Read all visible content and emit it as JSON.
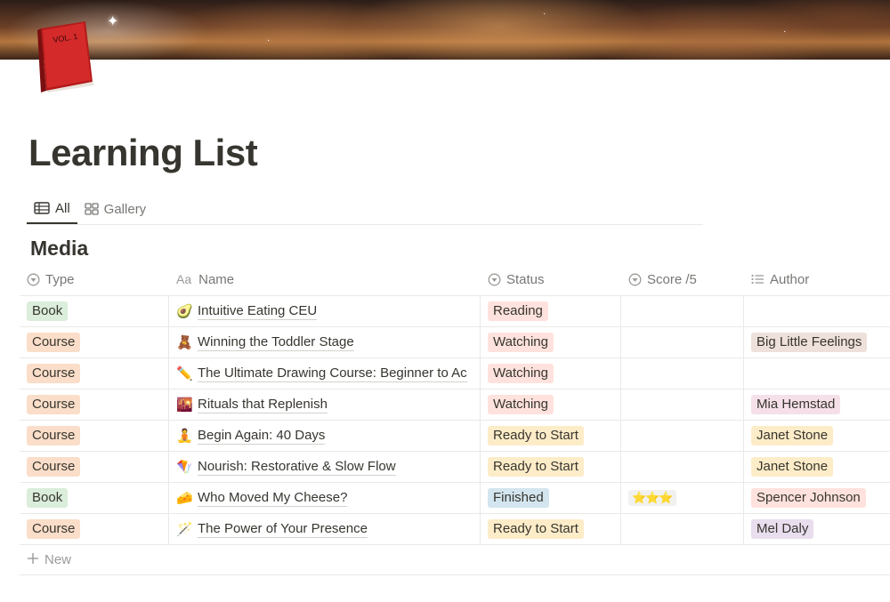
{
  "page": {
    "title": "Learning List",
    "icon": "red-book-icon",
    "icon_text": "VOL. 1"
  },
  "tabs": [
    {
      "label": "All",
      "icon": "table-icon",
      "active": true
    },
    {
      "label": "Gallery",
      "icon": "gallery-icon",
      "active": false
    }
  ],
  "section": {
    "title": "Media"
  },
  "columns": {
    "type": "Type",
    "name": "Name",
    "name_prefix": "Aa",
    "status": "Status",
    "score": "Score /5",
    "author": "Author"
  },
  "rows": [
    {
      "type": "Book",
      "emoji": "🥑",
      "name": "Intuitive Eating CEU",
      "status": "Reading",
      "score": "",
      "author": ""
    },
    {
      "type": "Course",
      "emoji": "🧸",
      "name": "Winning the Toddler Stage",
      "status": "Watching",
      "score": "",
      "author": "Big Little Feelings"
    },
    {
      "type": "Course",
      "emoji": "✏️",
      "name": "The Ultimate Drawing Course: Beginner to Ac",
      "status": "Watching",
      "score": "",
      "author": ""
    },
    {
      "type": "Course",
      "emoji": "🌇",
      "name": "Rituals that Replenish",
      "status": "Watching",
      "score": "",
      "author": "Mia Hemstad"
    },
    {
      "type": "Course",
      "emoji": "🧘",
      "name": "Begin Again: 40 Days",
      "status": "Ready to Start",
      "score": "",
      "author": "Janet Stone"
    },
    {
      "type": "Course",
      "emoji": "🪁",
      "name": "Nourish: Restorative & Slow Flow",
      "status": "Ready to Start",
      "score": "",
      "author": "Janet Stone"
    },
    {
      "type": "Book",
      "emoji": "🧀",
      "name": "Who Moved My Cheese?",
      "status": "Finished",
      "score": "⭐⭐⭐",
      "author": "Spencer Johnson"
    },
    {
      "type": "Course",
      "emoji": "🪄",
      "name": "The Power of Your Presence",
      "status": "Ready to Start",
      "score": "",
      "author": "Mel Daly"
    }
  ],
  "new_row_label": "New",
  "colors": {
    "type_book": "#dbeddb",
    "type_course": "#fadec9",
    "status_reading": "#ffe2dd",
    "status_watching": "#ffe2dd",
    "status_ready": "#fdecc8",
    "status_finished": "#d3e5ef",
    "author_big_little_feelings": "#eee0da",
    "author_mia_hemstad": "#f5e0e9",
    "author_janet_stone": "#fdecc8",
    "author_spencer_johnson": "#ffe2dd",
    "author_mel_daly": "#e8deee"
  }
}
